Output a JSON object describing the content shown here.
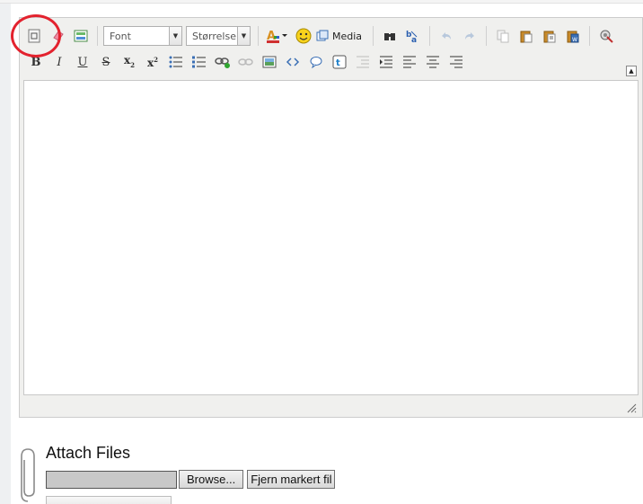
{
  "editor": {
    "font_select": "Font",
    "size_select": "Størrelse",
    "media_label": "Media",
    "format_buttons": {
      "bold": "B",
      "italic": "I",
      "underline": "U",
      "strike": "S",
      "subscript": "x",
      "subscript_mark": "2",
      "superscript": "x",
      "superscript_mark": "2"
    },
    "collapse_glyph": "▲",
    "select_arrow": "▼"
  },
  "attach": {
    "title": "Attach Files",
    "browse_label": "Browse...",
    "remove_label": "Fjern markert fil"
  },
  "colors": {
    "highlight_ring": "#e3222e",
    "toolbar_bg": "#f0f0ee",
    "accent_blue": "#3a6fb5"
  }
}
